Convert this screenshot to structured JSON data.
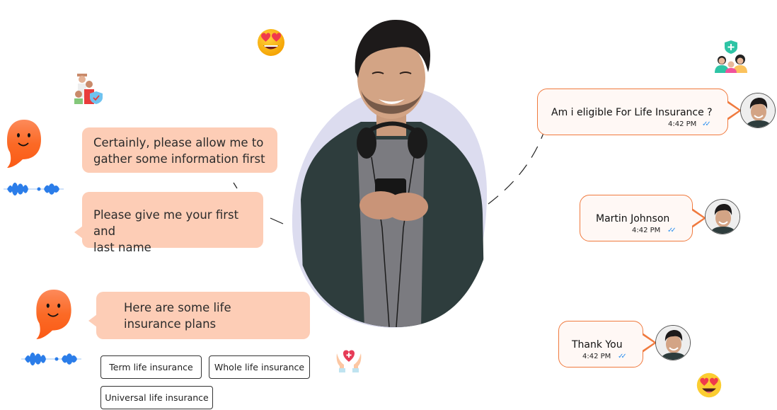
{
  "bot": {
    "messages": [
      {
        "text_line1": "Certainly, please allow me to",
        "text_line2": "gather some information first"
      },
      {
        "text_line1": "Please give me your first and",
        "text_line2": "last name"
      },
      {
        "text_line1": "Here are some life",
        "text_line2": "insurance plans"
      }
    ],
    "options": [
      {
        "label": "Term life insurance"
      },
      {
        "label": "Whole life insurance"
      },
      {
        "label": "Universal life insurance"
      }
    ]
  },
  "user": {
    "messages": [
      {
        "text": "Am i eligible For Life Insurance ?",
        "time": "4:42 PM",
        "status": "read"
      },
      {
        "text": "Martin Johnson",
        "time": "4:42 PM",
        "status": "read"
      },
      {
        "text": "Thank You",
        "time": "4:42 PM",
        "status": "read"
      }
    ],
    "tick_glyph": "✓✓"
  },
  "icons": {
    "bot_avatar": "smiling-chat-bubble-icon",
    "voice": "voice-waveform-icon",
    "heart_eyes": "heart-eyes-emoji",
    "family_insurance": "family-insurance-shield-icon",
    "group_health": "group-health-shield-icon",
    "care_hands": "hands-heart-icon"
  },
  "colors": {
    "bot_bubble": "#fdcdb6",
    "bot_icon": "#fb6a26",
    "user_border": "#f07a3e",
    "user_bubble": "#fff8f5",
    "blob": "#dcdcef",
    "wave": "#2b7de9",
    "tick": "#2b8ff0"
  }
}
